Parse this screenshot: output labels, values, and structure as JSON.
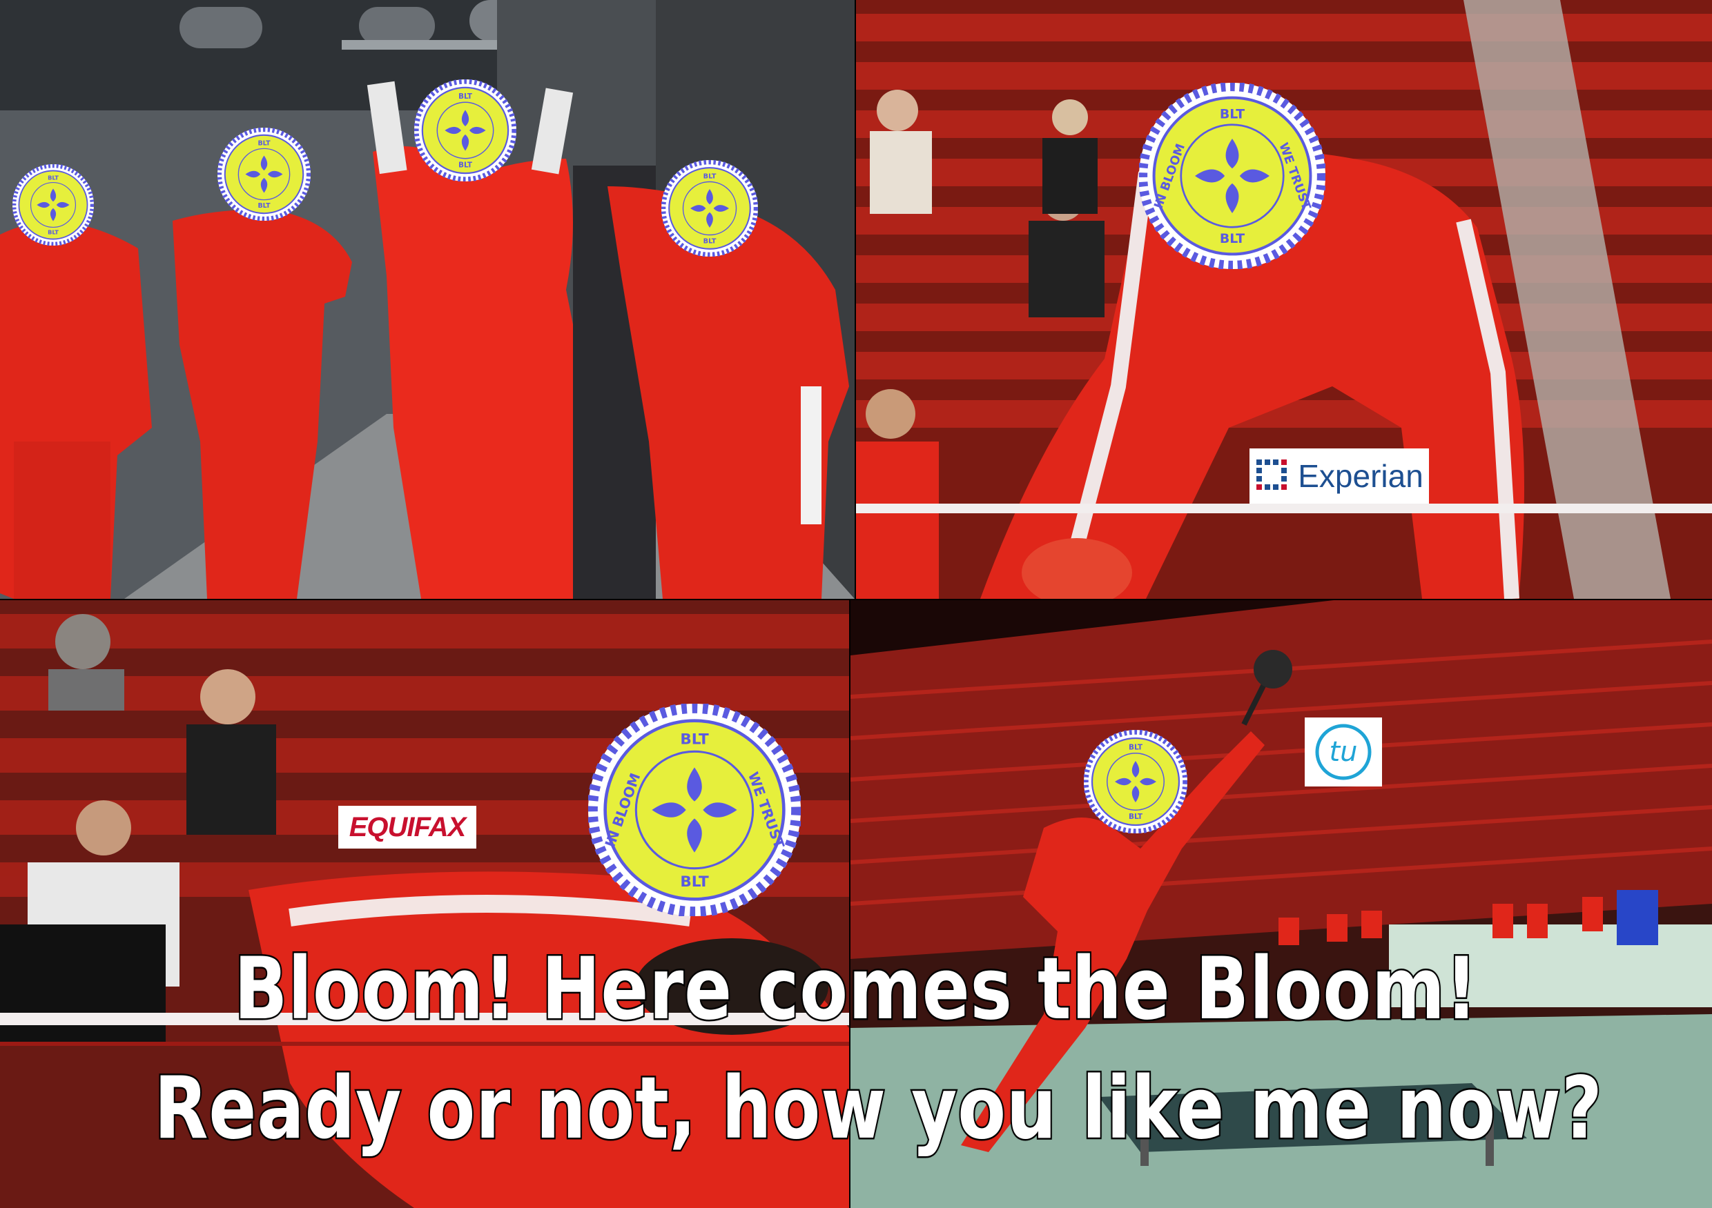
{
  "caption": {
    "line1": "Bloom! Here comes the Bloom!",
    "line2": "Ready or not, how you like me now?"
  },
  "coin": {
    "top_text": "BLT",
    "bottom_text": "BLT",
    "left_text": "IN BLOOM",
    "right_text": "WE TRUST",
    "face_color": "#e6ef3c",
    "ring_color": "#5a5ae0"
  },
  "logos": {
    "experian": "Experian",
    "equifax": "EQUIFAX",
    "transunion": "tu"
  },
  "colors": {
    "tracksuit_red": "#e0261a",
    "seat_red": "#a81c14",
    "experian_blue": "#1d4f91",
    "equifax_red": "#c8102e",
    "transunion_teal": "#1fa4d6"
  }
}
